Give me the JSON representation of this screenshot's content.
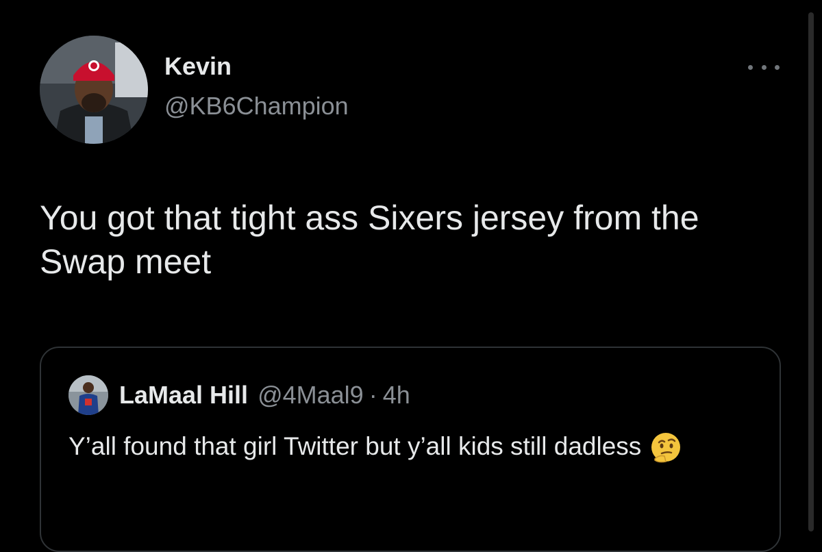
{
  "tweet": {
    "author": {
      "display_name": "Kevin",
      "handle": "@KB6Champion",
      "avatar": "profile-photo-red-georgia-beanie"
    },
    "more_icon": "more-horizontal-icon",
    "text": "You got that tight ass Sixers jersey from the Swap meet"
  },
  "quoted_tweet": {
    "author": {
      "display_name": "LaMaal Hill",
      "handle": "@4Maal9",
      "avatar": "profile-photo-blue-jersey"
    },
    "separator": "·",
    "time": "4h",
    "text": "Y’all found that girl Twitter but y’all kids still dadless",
    "emoji": "thinking-face-emoji"
  },
  "colors": {
    "background": "#000000",
    "text_primary": "#e7e9ea",
    "text_secondary": "#8b9096",
    "border": "#2f3336"
  }
}
